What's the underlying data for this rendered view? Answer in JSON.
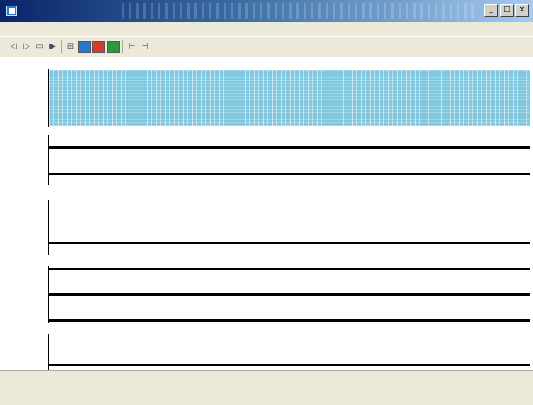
{
  "window": {
    "title": "",
    "controls": {
      "minimize": "_",
      "maximize": "□",
      "close": "×"
    }
  },
  "menu": {
    "items": [
      {
        "label": ""
      },
      {
        "label": ""
      },
      {
        "label": ""
      },
      {
        "label": ""
      },
      {
        "label": ""
      }
    ]
  },
  "toolbar": {
    "tools": [
      {
        "icon": "zoom-in-icon",
        "glyph": "◁"
      },
      {
        "icon": "zoom-out-icon",
        "glyph": "▷"
      },
      {
        "icon": "fit-icon",
        "glyph": "▭"
      },
      {
        "icon": "cursor-icon",
        "glyph": "▶"
      },
      {
        "icon": "grid-icon",
        "glyph": "⊞"
      },
      {
        "icon": "color-blue-icon",
        "color": "#2a78c8"
      },
      {
        "icon": "color-red-icon",
        "color": "#d83a2c"
      },
      {
        "icon": "color-green-icon",
        "color": "#2c9a3a"
      },
      {
        "icon": "range-left-icon",
        "glyph": "⊢"
      },
      {
        "icon": "range-right-icon",
        "glyph": "⊣"
      }
    ]
  },
  "traces": [
    {
      "title": "",
      "y_labels": [
        "",
        "",
        "",
        ""
      ],
      "kind": "spectrogram",
      "color": "#7fc8df"
    },
    {
      "title": "",
      "y_labels": [
        "",
        "",
        "",
        ""
      ],
      "kind": "lines"
    },
    {
      "title": "",
      "y_labels": [
        "",
        "",
        "",
        "",
        ""
      ],
      "kind": "lines"
    },
    {
      "title": "",
      "y_labels": [
        "",
        "",
        "",
        ""
      ],
      "kind": "lines"
    },
    {
      "title": "",
      "y_labels": [
        "",
        "",
        "",
        "",
        ""
      ],
      "kind": "lines"
    }
  ],
  "status": {
    "text": ""
  }
}
